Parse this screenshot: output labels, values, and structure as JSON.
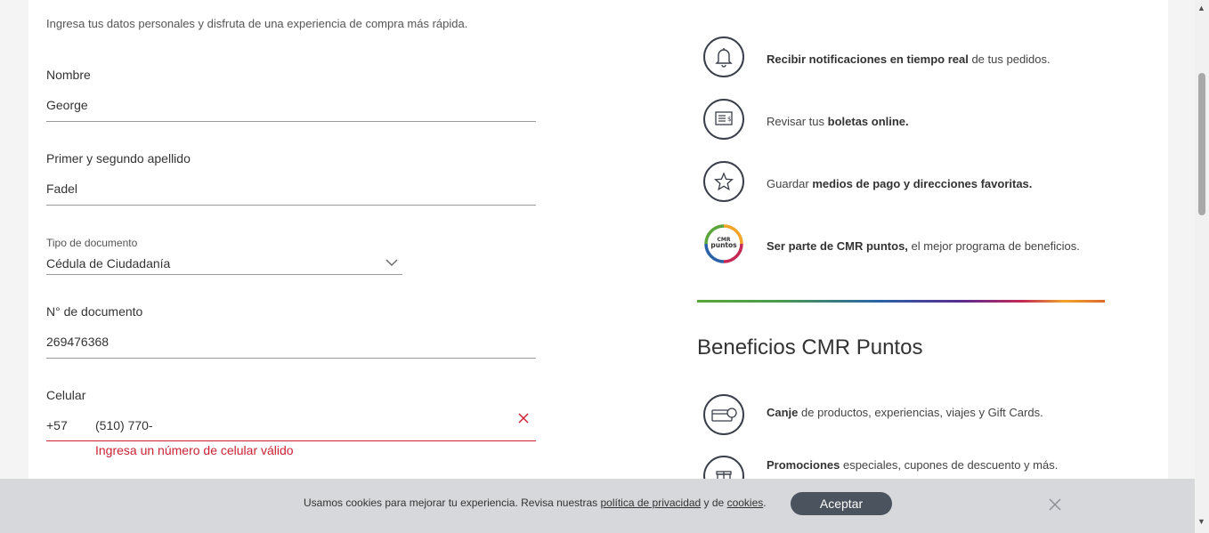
{
  "form": {
    "subtitle": "Ingresa tus datos personales y disfruta de una experiencia de compra más rápida.",
    "nombre_label": "Nombre",
    "nombre_value": "George",
    "apellido_label": "Primer y segundo apellido",
    "apellido_value": "Fadel",
    "tipo_doc_label": "Tipo de documento",
    "tipo_doc_value": "Cédula de Ciudadanía",
    "num_doc_label": "N° de documento",
    "num_doc_value": "269476368",
    "celular_label": "Celular",
    "celular_prefix": "+57",
    "celular_value": "(510) 770-",
    "celular_error": "Ingresa un número de celular válido"
  },
  "benefits": [
    {
      "icon": "bell-icon",
      "bold": "Recibir notificaciones en tiempo real",
      "rest": " de tus pedidos."
    },
    {
      "icon": "receipt-icon",
      "pre": "Revisar tus ",
      "bold": "boletas online."
    },
    {
      "icon": "star-icon",
      "pre": "Guardar ",
      "bold": "medios de pago y direcciones favoritas."
    },
    {
      "icon": "cmr-puntos-logo",
      "bold": "Ser parte de CMR puntos,",
      "rest": " el mejor programa de beneficios."
    }
  ],
  "cmr_logo_text": {
    "line1": "CMR",
    "line2": "puntos"
  },
  "cmr_section": {
    "title": "Beneficios CMR Puntos",
    "items": [
      {
        "icon": "gift-card-icon",
        "bold": "Canje",
        "rest": " de productos, experiencias, viajes y Gift Cards."
      },
      {
        "icon": "gift-icon",
        "bold": "Promociones",
        "rest": " especiales, cupones de descuento y más."
      }
    ]
  },
  "cookies": {
    "text_pre": "Usamos cookies para mejorar tu experiencia. Revisa nuestras ",
    "link1": "política de privacidad",
    "text_mid": " y de ",
    "link2": "cookies",
    "text_end": ".",
    "accept_label": "Aceptar"
  },
  "colors": {
    "error": "#cc2233",
    "accept_button": "#4a535e",
    "cookie_bar": "#d6d8db"
  }
}
